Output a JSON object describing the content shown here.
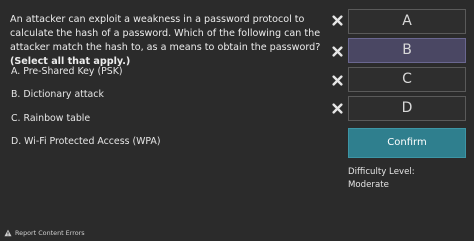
{
  "question": {
    "text": "An attacker can exploit a weakness in a password protocol to calculate the hash of a password. Which of the following can the attacker match the hash to, as a means to obtain the password?",
    "instruction": "(Select all that apply.)"
  },
  "options": [
    {
      "label": "A. Pre-Shared Key (PSK)"
    },
    {
      "label": "B. Dictionary attack"
    },
    {
      "label": "C. Rainbow table"
    },
    {
      "label": "D. Wi-Fi Protected Access (WPA)"
    }
  ],
  "answers": [
    {
      "letter": "A",
      "selected": false
    },
    {
      "letter": "B",
      "selected": true
    },
    {
      "letter": "C",
      "selected": false
    },
    {
      "letter": "D",
      "selected": false
    }
  ],
  "confirm_label": "Confirm",
  "difficulty": {
    "label": "Difficulty Level:",
    "value": "Moderate"
  },
  "report_label": "Report Content Errors",
  "colors": {
    "background": "#2b2b2b",
    "selected_answer": "#4a4763",
    "confirm": "#2f7f8e",
    "x_mark": "#e6e6e6"
  },
  "icons": {
    "answer_mark": "x-mark-icon",
    "report": "warning-icon"
  }
}
